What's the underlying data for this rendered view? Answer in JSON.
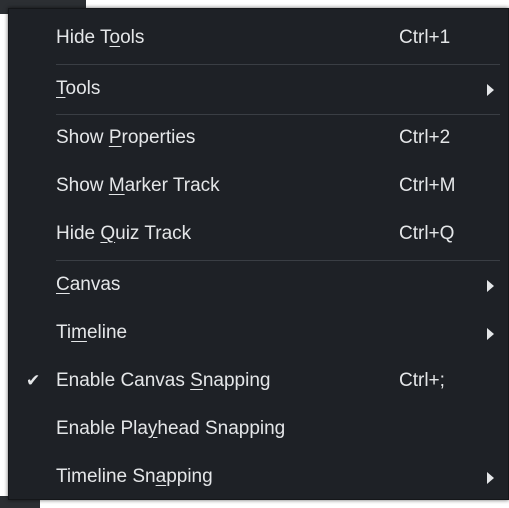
{
  "menu": {
    "items": [
      {
        "pre": "Hide T",
        "ul": "o",
        "post": "ols",
        "shortcut": "Ctrl+1",
        "submenu": false,
        "checked": false
      },
      {
        "pre": "",
        "ul": "T",
        "post": "ools",
        "shortcut": "",
        "submenu": true,
        "checked": false
      },
      {
        "pre": "Show ",
        "ul": "P",
        "post": "roperties",
        "shortcut": "Ctrl+2",
        "submenu": false,
        "checked": false
      },
      {
        "pre": "Show ",
        "ul": "M",
        "post": "arker Track",
        "shortcut": "Ctrl+M",
        "submenu": false,
        "checked": false
      },
      {
        "pre": "Hide ",
        "ul": "Q",
        "post": "uiz Track",
        "shortcut": "Ctrl+Q",
        "submenu": false,
        "checked": false
      },
      {
        "pre": "",
        "ul": "C",
        "post": "anvas",
        "shortcut": "",
        "submenu": true,
        "checked": false
      },
      {
        "pre": "Ti",
        "ul": "m",
        "post": "eline",
        "shortcut": "",
        "submenu": true,
        "checked": false
      },
      {
        "pre": "Enable Canvas ",
        "ul": "S",
        "post": "napping",
        "shortcut": "Ctrl+;",
        "submenu": false,
        "checked": true
      },
      {
        "pre": "Enable Pla",
        "ul": "y",
        "post": "head Snapping",
        "shortcut": "",
        "submenu": false,
        "checked": false
      },
      {
        "pre": "Timeline Sn",
        "ul": "a",
        "post": "pping",
        "shortcut": "",
        "submenu": true,
        "checked": false
      }
    ],
    "check_glyph": "✔",
    "colors": {
      "background": "#1e2126",
      "text": "#e4e6e8",
      "separator": "#3a3e44"
    }
  }
}
